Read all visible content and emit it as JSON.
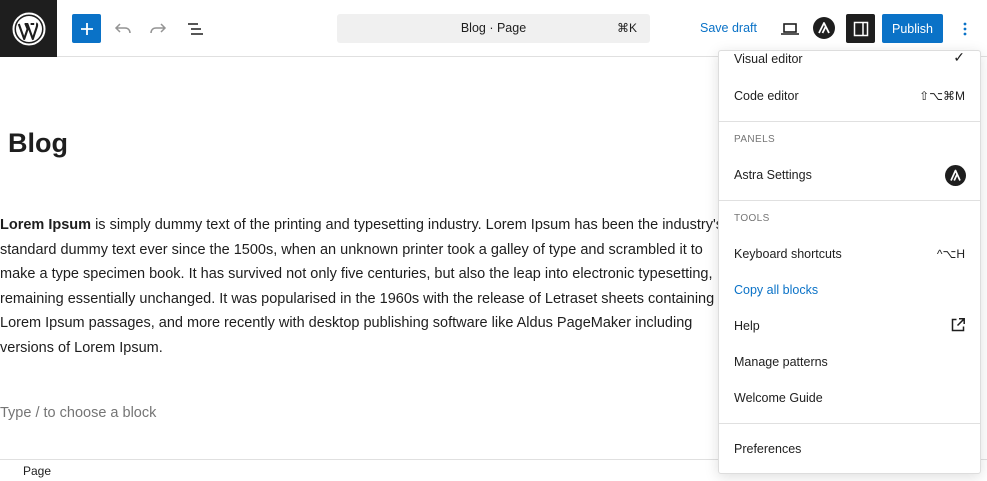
{
  "header": {
    "document_title": "Blog · Page",
    "command_shortcut": "⌘K",
    "save_draft_label": "Save draft",
    "publish_label": "Publish"
  },
  "content": {
    "title": "Blog",
    "paragraph_bold": "Lorem Ipsum",
    "paragraph_lines": [
      " is simply dummy text of the printing and typesetting industry. Lorem Ipsum has been the industry's",
      "standard dummy text ever since the 1500s, when an unknown printer took a galley of type and scrambled it to",
      "make a type specimen book. It has survived not only five centuries, but also the leap into electronic typesetting,",
      "remaining essentially unchanged. It was popularised in the 1960s with the release of Letraset sheets containing",
      "Lorem Ipsum passages, and more recently with desktop publishing software like Aldus PageMaker including",
      "versions of Lorem Ipsum."
    ],
    "block_placeholder": "Type / to choose a block"
  },
  "footer": {
    "breadcrumb": "Page"
  },
  "menu": {
    "visual_editor": "Visual editor",
    "visual_editor_check": "✓",
    "code_editor": "Code editor",
    "code_editor_shortcut": "⇧⌥⌘M",
    "panels_heading": "PANELS",
    "astra_settings": "Astra Settings",
    "tools_heading": "TOOLS",
    "keyboard_shortcuts": "Keyboard shortcuts",
    "keyboard_shortcuts_shortcut": "^⌥H",
    "copy_all_blocks": "Copy all blocks",
    "help": "Help",
    "manage_patterns": "Manage patterns",
    "welcome_guide": "Welcome Guide",
    "preferences": "Preferences"
  },
  "colors": {
    "accent": "#0a72c7",
    "dark": "#1e1e1e"
  },
  "icons": [
    "wordpress-logo-icon",
    "plus-icon",
    "undo-icon",
    "redo-icon",
    "document-overview-icon",
    "preview-laptop-icon",
    "astra-icon",
    "sidebar-toggle-icon",
    "more-vertical-icon",
    "checkmark-icon",
    "external-link-icon"
  ]
}
